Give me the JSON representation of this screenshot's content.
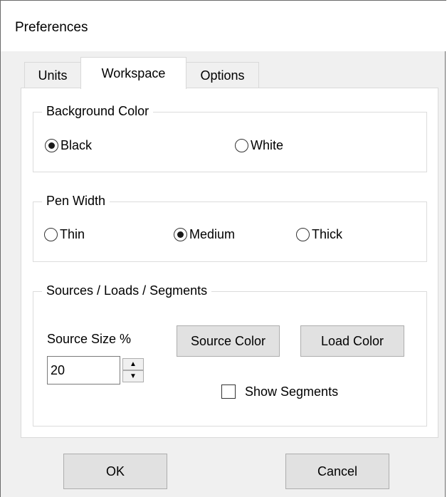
{
  "window": {
    "title": "Preferences"
  },
  "tabs": [
    {
      "label": "Units",
      "active": false
    },
    {
      "label": "Workspace",
      "active": true
    },
    {
      "label": "Options",
      "active": false
    }
  ],
  "background_color": {
    "legend": "Background Color",
    "options": [
      {
        "label": "Black",
        "selected": true
      },
      {
        "label": "White",
        "selected": false
      }
    ]
  },
  "pen_width": {
    "legend": "Pen Width",
    "options": [
      {
        "label": "Thin",
        "selected": false
      },
      {
        "label": "Medium",
        "selected": true
      },
      {
        "label": "Thick",
        "selected": false
      }
    ]
  },
  "sources": {
    "legend": "Sources / Loads / Segments",
    "source_size_label": "Source Size %",
    "source_size_value": "20",
    "source_color_label": "Source Color",
    "load_color_label": "Load Color",
    "show_segments_label": "Show Segments",
    "show_segments_checked": false
  },
  "footer": {
    "ok_label": "OK",
    "cancel_label": "Cancel"
  },
  "icons": {
    "spin_up": "triangle-up-icon",
    "spin_down": "triangle-down-icon"
  },
  "colors": {
    "window_bg": "#f0f0f0",
    "button_bg": "#e1e1e1",
    "border": "#adadad"
  }
}
